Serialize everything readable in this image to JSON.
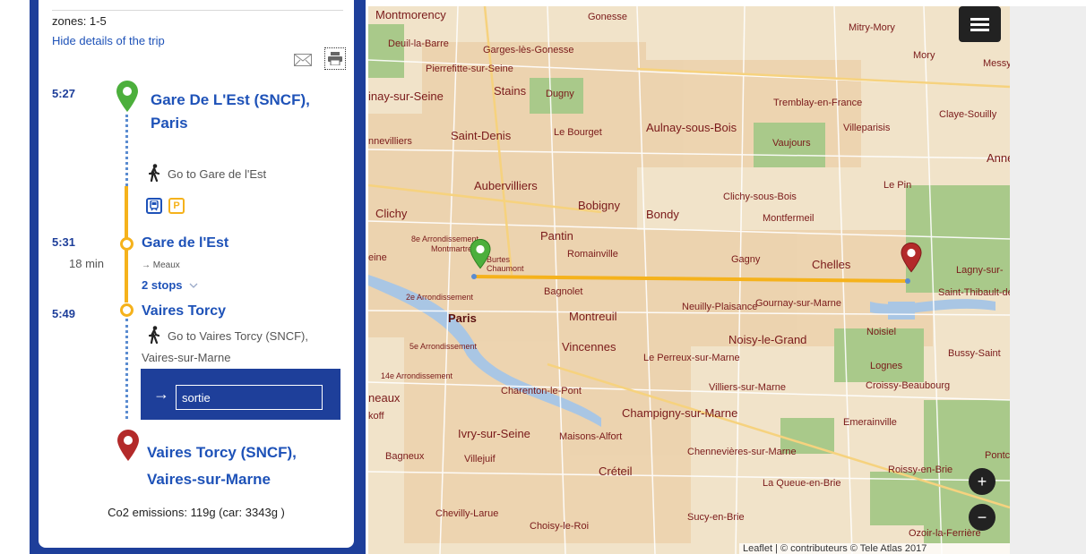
{
  "trip": {
    "zones": "zones: 1-5",
    "hide_details": "Hide details of the trip",
    "co2": "Co2 emissions: 119g (car: 3343g )"
  },
  "steps": {
    "origin": {
      "time": "5:27",
      "station_line1": "Gare De L'Est (SNCF),",
      "station_line2": "Paris"
    },
    "walk1": {
      "text": "Go to Gare de l'Est"
    },
    "board": {
      "time": "5:31",
      "duration": "18 min",
      "station": "Gare de l'Est",
      "direction": "→ Meaux",
      "stops": "2 stops"
    },
    "alight": {
      "time": "5:49",
      "station": "Vaires Torcy"
    },
    "walk2": {
      "text_line1": "Go to Vaires Torcy (SNCF),",
      "text_line2": "Vaires-sur-Marne"
    },
    "exit": {
      "arrow": "→",
      "value": "sortie"
    },
    "destination": {
      "station_line1": "Vaires Torcy (SNCF),",
      "station_line2": "Vaires-sur-Marne"
    }
  },
  "icons": {
    "mail": "mail-icon",
    "print": "printer-icon",
    "walk": "walking-person-icon",
    "train_badge": "train-icon",
    "parking_badge": "P"
  },
  "map": {
    "zoom_in": "+",
    "zoom_out": "−",
    "attribution": "Leaflet | © contributeurs © Tele Atlas 2017",
    "labels": [
      "Montmorency",
      "Gonesse",
      "Mitry-Mory",
      "Deuil-la-Barre",
      "Garges-lès-Gonesse",
      "Pierrefitte-sur-Seine",
      "inay-sur-Seine",
      "Stains",
      "Dugny",
      "Tremblay-en-France",
      "Aulnay-sous-Bois",
      "Claye-Souilly",
      "Saint-Denis",
      "Le Bourget",
      "Villeparisis",
      "Vaujours",
      "nnevilliers",
      "Anne",
      "Aubervilliers",
      "Clichy-sous-Bois",
      "Le Pin",
      "Clichy",
      "Bobigny",
      "Bondy",
      "Montfermeil",
      "Pantin",
      "Romainville",
      "Gagny",
      "Chelles",
      "Lagny-sur-",
      "eine",
      "Bagnolet",
      "Saint-Thibault-des-",
      "Paris",
      "Montreuil",
      "Neuilly-Plaisance",
      "Gournay-sur-Marne",
      "Noisy-le-Grand",
      "Noisiel",
      "Vincennes",
      "Le Perreux-sur-Marne",
      "Bussy-Saint",
      "Lognes",
      "Charenton-le-Pont",
      "Villiers-sur-Marne",
      "Croissy-Beaubourg",
      "neaux",
      "Champigny-sur-Marne",
      "Emerainville",
      "Ivry-sur-Seine",
      "Maisons-Alfort",
      "koff",
      "Bagneux",
      "Villejuif",
      "Chennevières-sur-Marne",
      "Pontc",
      "Créteil",
      "Roissy-en-Brie",
      "La Queue-en-Brie",
      "Chevilly-Larue",
      "Sucy-en-Brie",
      "Choisy-le-Roi",
      "Ozoir-la-Ferrière",
      "Mory",
      "Messy",
      "Burtes Chaumont",
      "8e Arrondissement",
      "2e Arrondissement",
      "5e Arrondissement",
      "14e Arrondissement",
      "Montmartre",
      "Villeparisis"
    ]
  },
  "colors": {
    "brand_blue": "#1e3f9a",
    "link_blue": "#1e52b8",
    "route_orange": "#f5b21c",
    "walk_dots": "#5b8cd0",
    "origin_pin": "#4caf3c",
    "destination_pin": "#b32a2a"
  }
}
